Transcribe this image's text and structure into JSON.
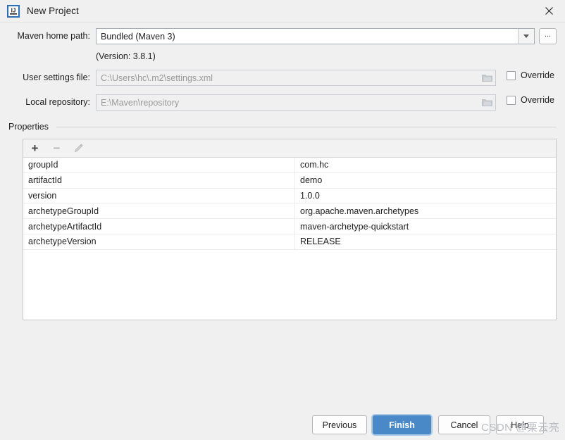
{
  "window": {
    "title": "New Project",
    "app_icon": "intellij-idea-icon",
    "close_icon": "close-icon"
  },
  "form": {
    "maven_home": {
      "label": "Maven home path:",
      "value": "Bundled (Maven 3)",
      "dropdown_icon": "chevron-down-icon",
      "browse_label": "...",
      "version_note": "(Version: 3.8.1)"
    },
    "user_settings": {
      "label": "User settings file:",
      "value": "C:\\Users\\hc\\.m2\\settings.xml",
      "folder_icon": "folder-icon",
      "override_label": "Override",
      "override_checked": false
    },
    "local_repository": {
      "label": "Local repository:",
      "value": "E:\\Maven\\repository",
      "folder_icon": "folder-icon",
      "override_label": "Override",
      "override_checked": false
    }
  },
  "properties": {
    "group_title": "Properties",
    "toolbar": {
      "add_icon": "plus-icon",
      "remove_icon": "minus-icon",
      "edit_icon": "pencil-icon"
    },
    "rows": [
      {
        "key": "groupId",
        "value": "com.hc"
      },
      {
        "key": "artifactId",
        "value": "demo"
      },
      {
        "key": "version",
        "value": "1.0.0"
      },
      {
        "key": "archetypeGroupId",
        "value": "org.apache.maven.archetypes"
      },
      {
        "key": "archetypeArtifactId",
        "value": "maven-archetype-quickstart"
      },
      {
        "key": "archetypeVersion",
        "value": "RELEASE"
      }
    ]
  },
  "footer": {
    "previous_label": "Previous",
    "finish_label": "Finish",
    "cancel_label": "Cancel",
    "help_label": "Help"
  },
  "watermark": {
    "text": "CSDN @栗云亮"
  },
  "colors": {
    "accent": "#4a89c8",
    "focus_ring": "#a9cbe8",
    "dialog_bg": "#f0f0f0",
    "field_bg": "#ffffff",
    "disabled_text": "#9a9a9a"
  }
}
